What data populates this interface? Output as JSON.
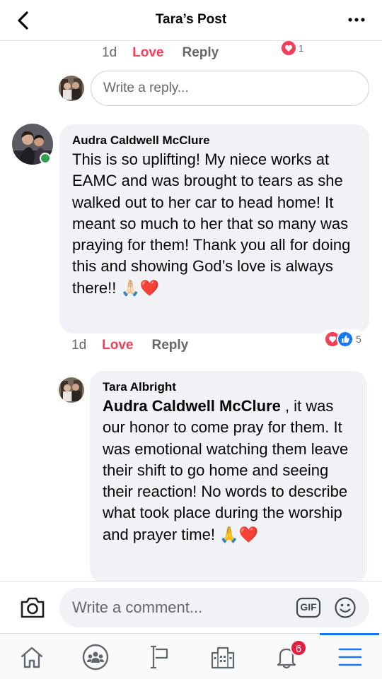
{
  "header": {
    "title": "Tara’s Post",
    "back_icon": "chevron-left-icon",
    "more_icon": "more-horizontal-icon"
  },
  "top_actions": {
    "time": "1d",
    "love": "Love",
    "reply": "Reply",
    "reaction_count": "1"
  },
  "reply_input": {
    "placeholder": "Write a reply..."
  },
  "comments": [
    {
      "author": "Audra Caldwell McClure",
      "text": "This is so uplifting! My niece works at EAMC and was brought to tears as she walked out to her car to head home! It meant so much to her that so many was praying for them! Thank you all for doing this and showing God’s love is always there!! 🙏🏻❤️",
      "online": true,
      "time": "1d",
      "love": "Love",
      "reply": "Reply",
      "reaction_count": "5",
      "reactions": [
        "love-reaction-icon",
        "like-reaction-icon"
      ]
    },
    {
      "author": "Tara Albright",
      "mention": "Audra Caldwell McClure",
      "text": " , it was our honor to come pray for them. It was emotional watching them leave their shift to go home and  seeing their reaction! No words to describe what took place during the worship and prayer time! 🙏❤️"
    }
  ],
  "comment_bar": {
    "placeholder": "Write a comment...",
    "camera_icon": "camera-icon",
    "gif_label": "GIF",
    "emoji_icon": "smiley-icon"
  },
  "bottom_nav": {
    "items": [
      "home-icon",
      "groups-icon",
      "pages-flag-icon",
      "marketplace-icon",
      "notifications-bell-icon",
      "menu-icon"
    ],
    "notification_count": "6",
    "active": "menu-icon"
  },
  "colors": {
    "love": "#f33e58",
    "like": "#1877f2",
    "bubble": "#f0f2f5",
    "secondary_text": "#65676b",
    "online": "#31a24c",
    "badge": "#e41e3f"
  }
}
